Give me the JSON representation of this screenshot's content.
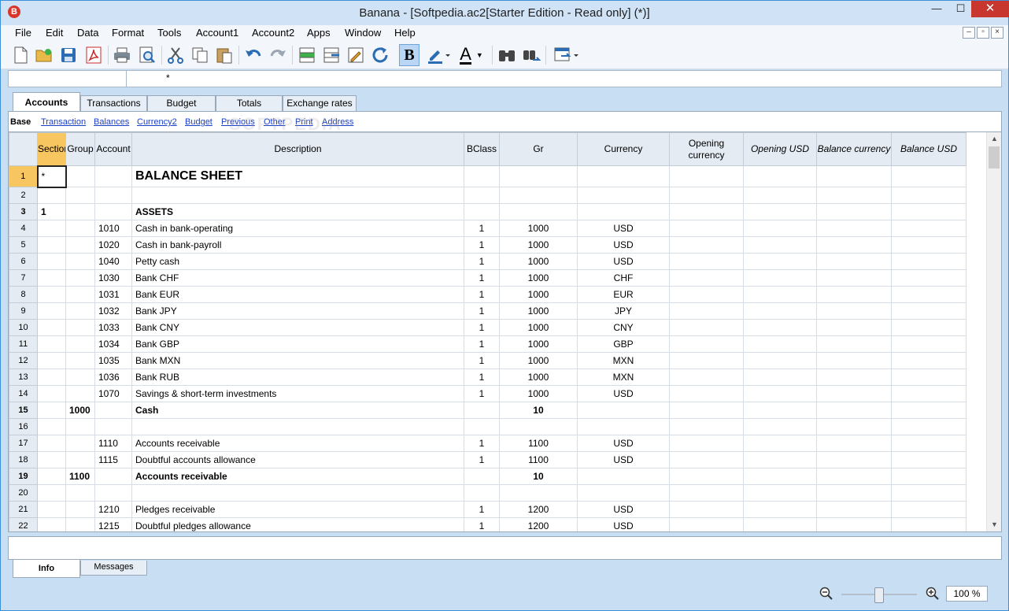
{
  "window": {
    "title": "Banana - [Softpedia.ac2[Starter Edition - Read only] (*)]",
    "app_icon": "banana-app-icon",
    "app_icon_glyph": "B",
    "min_glyph": "—",
    "max_glyph": "☐",
    "close_glyph": "✕"
  },
  "menu": [
    "File",
    "Edit",
    "Data",
    "Format",
    "Tools",
    "Account1",
    "Account2",
    "Apps",
    "Window",
    "Help"
  ],
  "mdi_controls": {
    "minimize": "–",
    "restore": "▫",
    "close": "×"
  },
  "toolbar": {
    "icons": [
      "new-file-icon",
      "open-folder-icon",
      "save-icon",
      "pdf-icon",
      "print-icon",
      "print-preview-icon",
      "cut-icon",
      "copy-icon",
      "paste-icon",
      "undo-icon",
      "redo-icon",
      "insert-rows-icon",
      "delete-rows-icon",
      "edit-cell-icon",
      "recalculate-icon",
      "bold-icon",
      "highlight-color-icon",
      "font-color-icon",
      "find-icon",
      "replace-icon",
      "window-icon"
    ],
    "bold_label": "B",
    "font_color_label": "A",
    "accent": "#2b6cb3"
  },
  "formula_bar": {
    "cell_ref": "",
    "content": "*"
  },
  "tabs": [
    "Accounts",
    "Transactions",
    "Budget",
    "Totals",
    "Exchange rates"
  ],
  "views": [
    "Base",
    "Transaction",
    "Balances",
    "Currency2",
    "Budget",
    "Previous",
    "Other",
    "Print",
    "Address"
  ],
  "watermark": "SOFTPEDIA",
  "table": {
    "columns": [
      "Section",
      "Group",
      "Account",
      "Description",
      "BClass",
      "Gr",
      "Currency",
      "Opening currency",
      "Opening USD",
      "Balance currency",
      "Balance USD"
    ],
    "rows": [
      {
        "n": "1",
        "section": "*",
        "group": "",
        "account": "",
        "desc": "BALANCE SHEET",
        "bclass": "",
        "gr": "",
        "cur": ""
      },
      {
        "n": "2",
        "section": "",
        "group": "",
        "account": "",
        "desc": "",
        "bclass": "",
        "gr": "",
        "cur": ""
      },
      {
        "n": "3",
        "section": "1",
        "group": "",
        "account": "",
        "desc": "ASSETS",
        "bclass": "",
        "gr": "",
        "cur": ""
      },
      {
        "n": "4",
        "section": "",
        "group": "",
        "account": "1010",
        "desc": "Cash in bank-operating",
        "bclass": "1",
        "gr": "1000",
        "cur": "USD"
      },
      {
        "n": "5",
        "section": "",
        "group": "",
        "account": "1020",
        "desc": "Cash in bank-payroll",
        "bclass": "1",
        "gr": "1000",
        "cur": "USD"
      },
      {
        "n": "6",
        "section": "",
        "group": "",
        "account": "1040",
        "desc": "Petty cash",
        "bclass": "1",
        "gr": "1000",
        "cur": "USD"
      },
      {
        "n": "7",
        "section": "",
        "group": "",
        "account": "1030",
        "desc": "Bank CHF",
        "bclass": "1",
        "gr": "1000",
        "cur": "CHF"
      },
      {
        "n": "8",
        "section": "",
        "group": "",
        "account": "1031",
        "desc": "Bank EUR",
        "bclass": "1",
        "gr": "1000",
        "cur": "EUR"
      },
      {
        "n": "9",
        "section": "",
        "group": "",
        "account": "1032",
        "desc": "Bank JPY",
        "bclass": "1",
        "gr": "1000",
        "cur": "JPY"
      },
      {
        "n": "10",
        "section": "",
        "group": "",
        "account": "1033",
        "desc": "Bank CNY",
        "bclass": "1",
        "gr": "1000",
        "cur": "CNY"
      },
      {
        "n": "11",
        "section": "",
        "group": "",
        "account": "1034",
        "desc": "Bank GBP",
        "bclass": "1",
        "gr": "1000",
        "cur": "GBP"
      },
      {
        "n": "12",
        "section": "",
        "group": "",
        "account": "1035",
        "desc": "Bank MXN",
        "bclass": "1",
        "gr": "1000",
        "cur": "MXN"
      },
      {
        "n": "13",
        "section": "",
        "group": "",
        "account": "1036",
        "desc": "Bank RUB",
        "bclass": "1",
        "gr": "1000",
        "cur": "MXN"
      },
      {
        "n": "14",
        "section": "",
        "group": "",
        "account": "1070",
        "desc": "Savings & short-term investments",
        "bclass": "1",
        "gr": "1000",
        "cur": "USD"
      },
      {
        "n": "15",
        "section": "",
        "group": "1000",
        "account": "",
        "desc": "Cash",
        "bclass": "",
        "gr": "10",
        "cur": ""
      },
      {
        "n": "16",
        "section": "",
        "group": "",
        "account": "",
        "desc": "",
        "bclass": "",
        "gr": "",
        "cur": ""
      },
      {
        "n": "17",
        "section": "",
        "group": "",
        "account": "1110",
        "desc": "Accounts receivable",
        "bclass": "1",
        "gr": "1100",
        "cur": "USD"
      },
      {
        "n": "18",
        "section": "",
        "group": "",
        "account": "1115",
        "desc": "Doubtful accounts allowance",
        "bclass": "1",
        "gr": "1100",
        "cur": "USD"
      },
      {
        "n": "19",
        "section": "",
        "group": "1100",
        "account": "",
        "desc": "Accounts receivable",
        "bclass": "",
        "gr": "10",
        "cur": ""
      },
      {
        "n": "20",
        "section": "",
        "group": "",
        "account": "",
        "desc": "",
        "bclass": "",
        "gr": "",
        "cur": ""
      },
      {
        "n": "21",
        "section": "",
        "group": "",
        "account": "1210",
        "desc": "Pledges receivable",
        "bclass": "1",
        "gr": "1200",
        "cur": "USD"
      },
      {
        "n": "22",
        "section": "",
        "group": "",
        "account": "1215",
        "desc": "Doubtful pledges allowance",
        "bclass": "1",
        "gr": "1200",
        "cur": "USD"
      }
    ]
  },
  "bottom_tabs": [
    "Info",
    "Messages"
  ],
  "scroll": {
    "up": "▲",
    "down": "▼"
  },
  "zoom": {
    "value": "100 %",
    "out_icon": "zoom-out-icon",
    "in_icon": "zoom-in-icon",
    "level_percent": 100
  }
}
